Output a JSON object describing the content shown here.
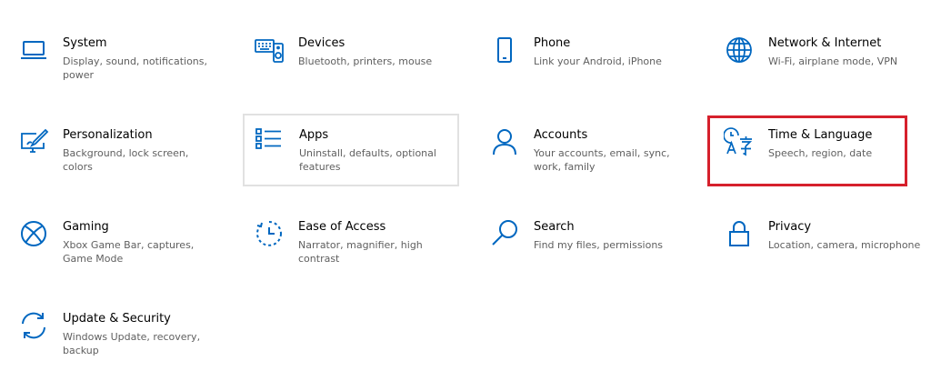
{
  "accent_color": "#0067c0",
  "highlight_color": "#d6202c",
  "tiles": [
    {
      "id": "system",
      "icon": "laptop-icon",
      "title": "System",
      "desc": "Display, sound, notifications, power"
    },
    {
      "id": "devices",
      "icon": "keyboard-speaker-icon",
      "title": "Devices",
      "desc": "Bluetooth, printers, mouse"
    },
    {
      "id": "phone",
      "icon": "phone-icon",
      "title": "Phone",
      "desc": "Link your Android, iPhone"
    },
    {
      "id": "network",
      "icon": "globe-icon",
      "title": "Network & Internet",
      "desc": "Wi-Fi, airplane mode, VPN"
    },
    {
      "id": "personalization",
      "icon": "paint-brush-monitor-icon",
      "title": "Personalization",
      "desc": "Background, lock screen, colors"
    },
    {
      "id": "apps",
      "icon": "app-list-icon",
      "title": "Apps",
      "desc": "Uninstall, defaults, optional features"
    },
    {
      "id": "accounts",
      "icon": "person-icon",
      "title": "Accounts",
      "desc": "Your accounts, email, sync, work, family"
    },
    {
      "id": "time-language",
      "icon": "clock-language-icon",
      "title": "Time & Language",
      "desc": "Speech, region, date"
    },
    {
      "id": "gaming",
      "icon": "xbox-icon",
      "title": "Gaming",
      "desc": "Xbox Game Bar, captures, Game Mode"
    },
    {
      "id": "ease-of-access",
      "icon": "ease-of-access-icon",
      "title": "Ease of Access",
      "desc": "Narrator, magnifier, high contrast"
    },
    {
      "id": "search",
      "icon": "magnifier-icon",
      "title": "Search",
      "desc": "Find my files, permissions"
    },
    {
      "id": "privacy",
      "icon": "padlock-icon",
      "title": "Privacy",
      "desc": "Location, camera, microphone"
    },
    {
      "id": "update-security",
      "icon": "sync-arrows-icon",
      "title": "Update & Security",
      "desc": "Windows Update, recovery, backup"
    }
  ]
}
